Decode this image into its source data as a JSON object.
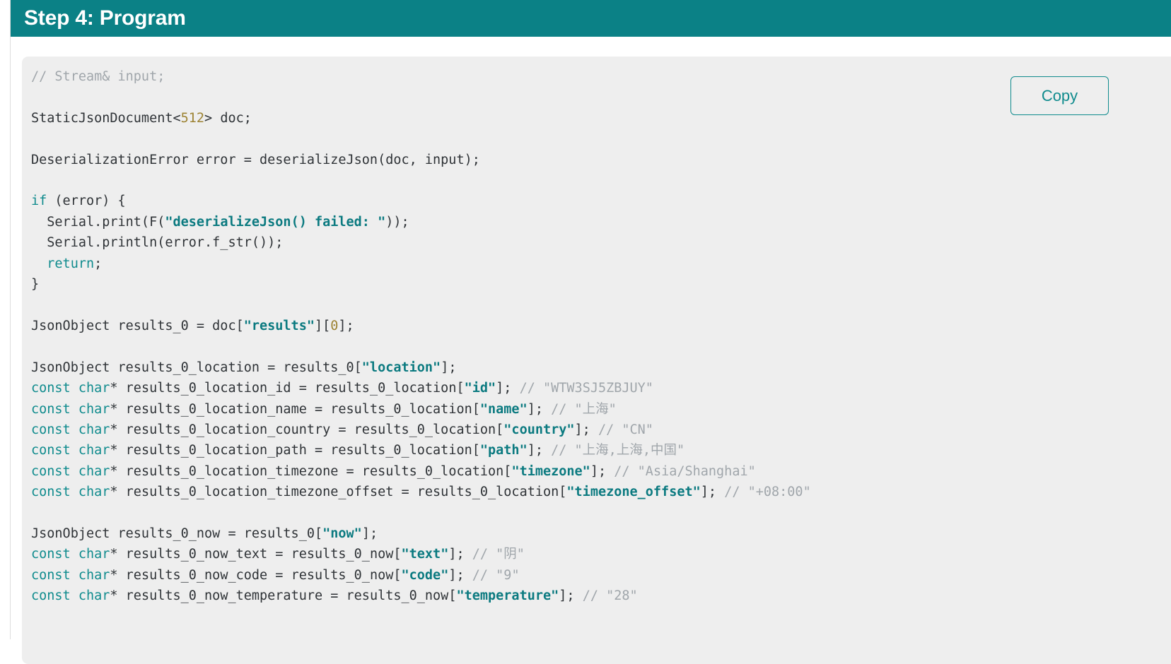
{
  "header": {
    "title": "Step 4: Program",
    "background_color": "#0b8186",
    "text_color": "#ffffff"
  },
  "code_panel": {
    "background_color": "#eeeeee",
    "language": "cpp",
    "copy_button_label": "Copy",
    "copy_button_color": "#0f8b8d",
    "syntax_colors": {
      "comment": "#a0a6ab",
      "keyword": "#0f8b8d",
      "string": "#0b7a80",
      "number": "#9d8333",
      "plain": "#2f3337"
    },
    "lines": [
      [
        {
          "t": "// Stream& input;",
          "c": "com"
        }
      ],
      [],
      [
        {
          "t": "StaticJsonDocument<",
          "c": "txt"
        },
        {
          "t": "512",
          "c": "num"
        },
        {
          "t": "> doc;",
          "c": "txt"
        }
      ],
      [],
      [
        {
          "t": "DeserializationError error = deserializeJson(doc, input);",
          "c": "txt"
        }
      ],
      [],
      [
        {
          "t": "if",
          "c": "key"
        },
        {
          "t": " (error) {",
          "c": "txt"
        }
      ],
      [
        {
          "t": "  Serial.print(F(",
          "c": "txt"
        },
        {
          "t": "\"deserializeJson() failed: \"",
          "c": "str"
        },
        {
          "t": "));",
          "c": "txt"
        }
      ],
      [
        {
          "t": "  Serial.println(error.f_str());",
          "c": "txt"
        }
      ],
      [
        {
          "t": "  ",
          "c": "txt"
        },
        {
          "t": "return",
          "c": "key"
        },
        {
          "t": ";",
          "c": "txt"
        }
      ],
      [
        {
          "t": "}",
          "c": "txt"
        }
      ],
      [],
      [
        {
          "t": "JsonObject results_0 = doc[",
          "c": "txt"
        },
        {
          "t": "\"results\"",
          "c": "str"
        },
        {
          "t": "][",
          "c": "txt"
        },
        {
          "t": "0",
          "c": "num"
        },
        {
          "t": "];",
          "c": "txt"
        }
      ],
      [],
      [
        {
          "t": "JsonObject results_0_location = results_0[",
          "c": "txt"
        },
        {
          "t": "\"location\"",
          "c": "str"
        },
        {
          "t": "];",
          "c": "txt"
        }
      ],
      [
        {
          "t": "const char",
          "c": "key"
        },
        {
          "t": "* results_0_location_id = results_0_location[",
          "c": "txt"
        },
        {
          "t": "\"id\"",
          "c": "str"
        },
        {
          "t": "]; ",
          "c": "txt"
        },
        {
          "t": "// \"WTW3SJ5ZBJUY\"",
          "c": "com"
        }
      ],
      [
        {
          "t": "const char",
          "c": "key"
        },
        {
          "t": "* results_0_location_name = results_0_location[",
          "c": "txt"
        },
        {
          "t": "\"name\"",
          "c": "str"
        },
        {
          "t": "]; ",
          "c": "txt"
        },
        {
          "t": "// \"上海\"",
          "c": "com"
        }
      ],
      [
        {
          "t": "const char",
          "c": "key"
        },
        {
          "t": "* results_0_location_country = results_0_location[",
          "c": "txt"
        },
        {
          "t": "\"country\"",
          "c": "str"
        },
        {
          "t": "]; ",
          "c": "txt"
        },
        {
          "t": "// \"CN\"",
          "c": "com"
        }
      ],
      [
        {
          "t": "const char",
          "c": "key"
        },
        {
          "t": "* results_0_location_path = results_0_location[",
          "c": "txt"
        },
        {
          "t": "\"path\"",
          "c": "str"
        },
        {
          "t": "]; ",
          "c": "txt"
        },
        {
          "t": "// \"上海,上海,中国\"",
          "c": "com"
        }
      ],
      [
        {
          "t": "const char",
          "c": "key"
        },
        {
          "t": "* results_0_location_timezone = results_0_location[",
          "c": "txt"
        },
        {
          "t": "\"timezone\"",
          "c": "str"
        },
        {
          "t": "]; ",
          "c": "txt"
        },
        {
          "t": "// \"Asia/Shanghai\"",
          "c": "com"
        }
      ],
      [
        {
          "t": "const char",
          "c": "key"
        },
        {
          "t": "* results_0_location_timezone_offset = results_0_location[",
          "c": "txt"
        },
        {
          "t": "\"timezone_offset\"",
          "c": "str"
        },
        {
          "t": "]; ",
          "c": "txt"
        },
        {
          "t": "// \"+08:00\"",
          "c": "com"
        }
      ],
      [],
      [
        {
          "t": "JsonObject results_0_now = results_0[",
          "c": "txt"
        },
        {
          "t": "\"now\"",
          "c": "str"
        },
        {
          "t": "];",
          "c": "txt"
        }
      ],
      [
        {
          "t": "const char",
          "c": "key"
        },
        {
          "t": "* results_0_now_text = results_0_now[",
          "c": "txt"
        },
        {
          "t": "\"text\"",
          "c": "str"
        },
        {
          "t": "]; ",
          "c": "txt"
        },
        {
          "t": "// \"阴\"",
          "c": "com"
        }
      ],
      [
        {
          "t": "const char",
          "c": "key"
        },
        {
          "t": "* results_0_now_code = results_0_now[",
          "c": "txt"
        },
        {
          "t": "\"code\"",
          "c": "str"
        },
        {
          "t": "]; ",
          "c": "txt"
        },
        {
          "t": "// \"9\"",
          "c": "com"
        }
      ],
      [
        {
          "t": "const char",
          "c": "key"
        },
        {
          "t": "* results_0_now_temperature = results_0_now[",
          "c": "txt"
        },
        {
          "t": "\"temperature\"",
          "c": "str"
        },
        {
          "t": "]; ",
          "c": "txt"
        },
        {
          "t": "// \"28\"",
          "c": "com"
        }
      ]
    ]
  }
}
